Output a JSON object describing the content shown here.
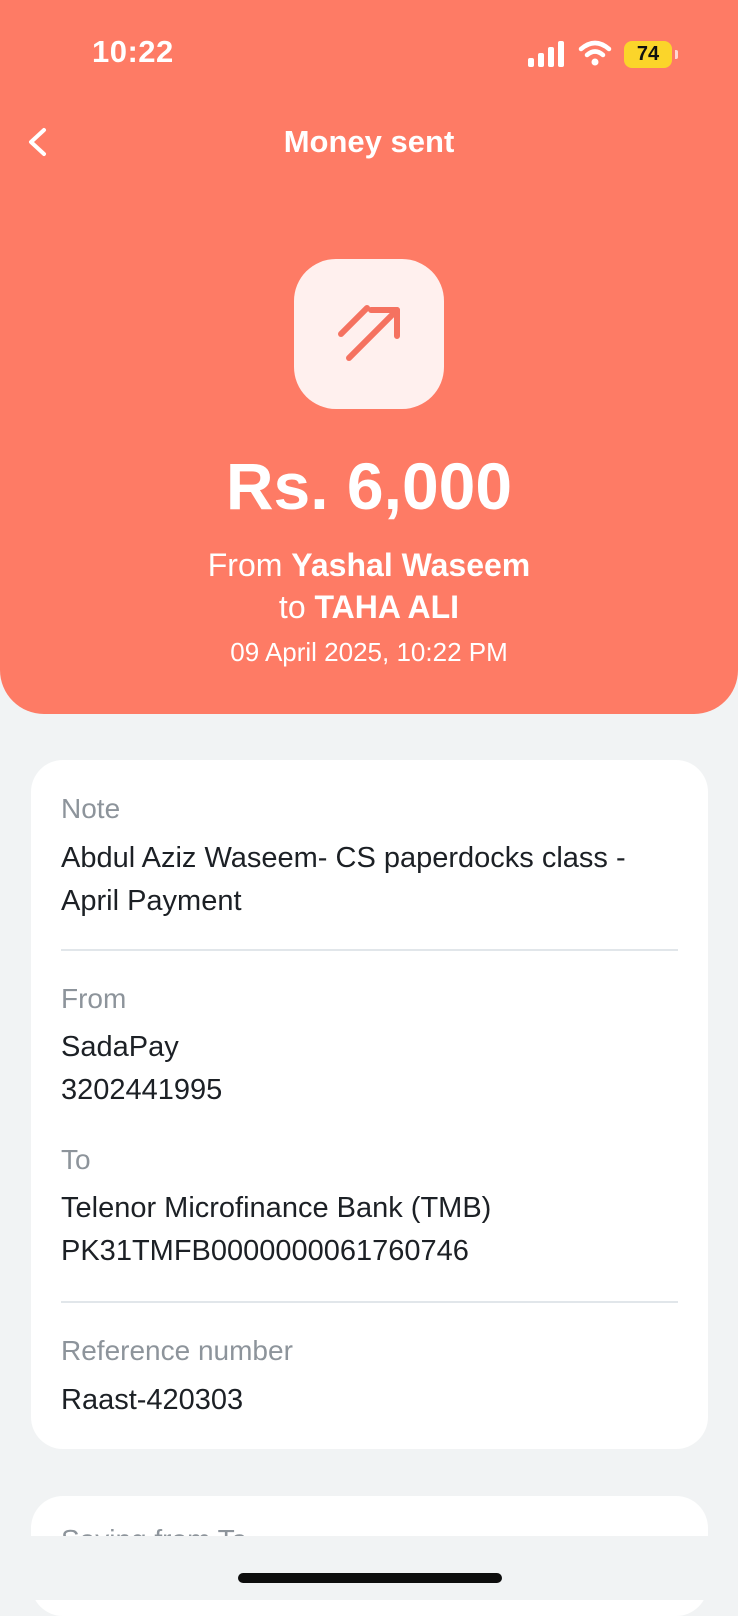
{
  "status_bar": {
    "time": "10:22",
    "battery_level": "74"
  },
  "header": {
    "title": "Money sent",
    "amount": "Rs. 6,000",
    "from_prefix": "From",
    "from_name": "Yashal Waseem",
    "to_prefix": "to",
    "to_name": "TAHA ALI",
    "datetime": "09 April 2025, 10:22 PM",
    "icon": "arrow-up-right-icon",
    "accent_color": "#fe7b65"
  },
  "details": {
    "note_label": "Note",
    "note_value": "Abdul Aziz Waseem- CS paperdocks class - April Payment",
    "from_label": "From",
    "from_bank": "SadaPay",
    "from_account": "3202441995",
    "to_label": "To",
    "to_bank": "Telenor Microfinance Bank (TMB)",
    "to_account": "PK31TMFB0000000061760746",
    "reference_label": "Reference number",
    "reference_value": "Raast-420303"
  },
  "next_card": {
    "partial_text": "Saving from Ta"
  }
}
